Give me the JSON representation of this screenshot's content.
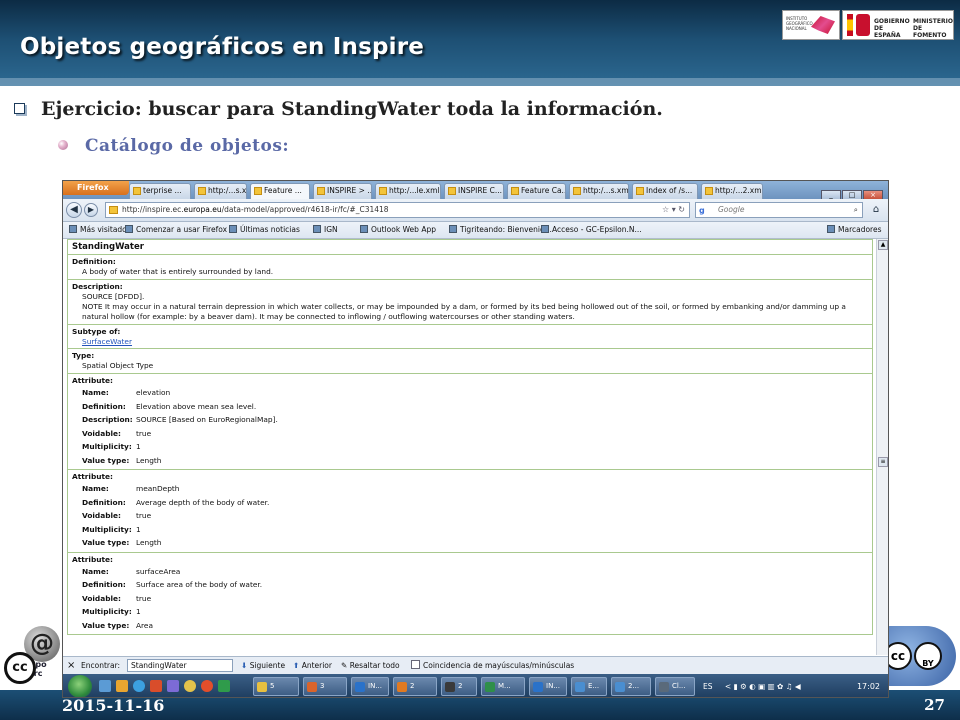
{
  "slide": {
    "title": "Objetos geográficos en Inspire",
    "bullet1": "Ejercicio: buscar para StandingWater toda la información.",
    "bullet2": "Catálogo de objetos:",
    "date": "2015-11-16",
    "page_number": "27"
  },
  "logos": {
    "ign_text": "INSTITUTO GEOGRÁFICO NACIONAL",
    "gob_text": "GOBIERNO DE ESPAÑA",
    "ministerio_text": "MINISTERIO DE FOMENTO",
    "grupo_text": "grupo merc",
    "cc_left": "cc",
    "cc_right": "cc",
    "by_text": "BY"
  },
  "browser": {
    "firefox_button": "Firefox",
    "tabs": [
      {
        "label": "terprise ..."
      },
      {
        "label": "http:/...s.xsd"
      },
      {
        "label": "Feature ..."
      },
      {
        "label": "INSPIRE > ..."
      },
      {
        "label": "http:/...le.xml"
      },
      {
        "label": "INSPIRE C..."
      },
      {
        "label": "Feature Ca..."
      },
      {
        "label": "http:/...s.xml"
      },
      {
        "label": "Index of /s..."
      },
      {
        "label": "http:/...2.xml"
      }
    ],
    "url_prefix": "http://inspire.ec.",
    "url_domain": "europa.eu",
    "url_rest": "/data-model/approved/r4618-ir/fc/#_C31418",
    "search_placeholder": "Google",
    "bookmarks": [
      {
        "label": "Más visitados"
      },
      {
        "label": "Comenzar a usar Firefox"
      },
      {
        "label": "Últimas noticias"
      },
      {
        "label": "IGN"
      },
      {
        "label": "Outlook Web App"
      },
      {
        "label": "Tigriteando: Bienvenid..."
      },
      {
        "label": "Acceso - GC-Epsilon.N..."
      }
    ],
    "bookmarks_menu": "Marcadores",
    "findbar": {
      "close": "×",
      "label": "Encontrar:",
      "value": "StandingWater",
      "next": "Siguiente",
      "prev": "Anterior",
      "highlight": "Resaltar todo",
      "match_case": "Coincidencia de mayúsculas/minúsculas"
    },
    "taskbar": {
      "items": [
        "5",
        "3",
        "IN...",
        "2",
        "2",
        "M...",
        "IN...",
        "E...",
        "2...",
        "Cl..."
      ],
      "lang": "ES",
      "clock": "17:02"
    }
  },
  "feature": {
    "name": "StandingWater",
    "definition_label": "Definition:",
    "definition": "A body of water that is entirely surrounded by land.",
    "description_label": "Description:",
    "description_source": "SOURCE [DFDD].",
    "description_note": "NOTE It may occur in a natural terrain depression in which water collects, or may be impounded by a dam, or formed by its bed being hollowed out of the soil, or formed by embanking and/or damming up a natural hollow (for example: by a beaver dam). It may be connected to inflowing / outflowing watercourses or other standing waters.",
    "subtype_label": "Subtype of:",
    "subtype": "SurfaceWater",
    "type_label": "Type:",
    "type": "Spatial Object Type",
    "attribute_label": "Attribute:",
    "attributes": [
      {
        "rows": [
          {
            "k": "Name:",
            "v": "elevation"
          },
          {
            "k": "Definition:",
            "v": "Elevation above mean sea level."
          },
          {
            "k": "Description:",
            "v": "SOURCE [Based on EuroRegionalMap]."
          },
          {
            "k": "Voidable:",
            "v": "true"
          },
          {
            "k": "Multiplicity:",
            "v": "1"
          },
          {
            "k": "Value type:",
            "v": "Length"
          }
        ]
      },
      {
        "rows": [
          {
            "k": "Name:",
            "v": "meanDepth"
          },
          {
            "k": "Definition:",
            "v": "Average depth of the body of water."
          },
          {
            "k": "Voidable:",
            "v": "true"
          },
          {
            "k": "Multiplicity:",
            "v": "1"
          },
          {
            "k": "Value type:",
            "v": "Length"
          }
        ]
      },
      {
        "rows": [
          {
            "k": "Name:",
            "v": "surfaceArea"
          },
          {
            "k": "Definition:",
            "v": "Surface area of the body of water."
          },
          {
            "k": "Voidable:",
            "v": "true"
          },
          {
            "k": "Multiplicity:",
            "v": "1"
          },
          {
            "k": "Value type:",
            "v": "Area"
          }
        ]
      }
    ]
  }
}
